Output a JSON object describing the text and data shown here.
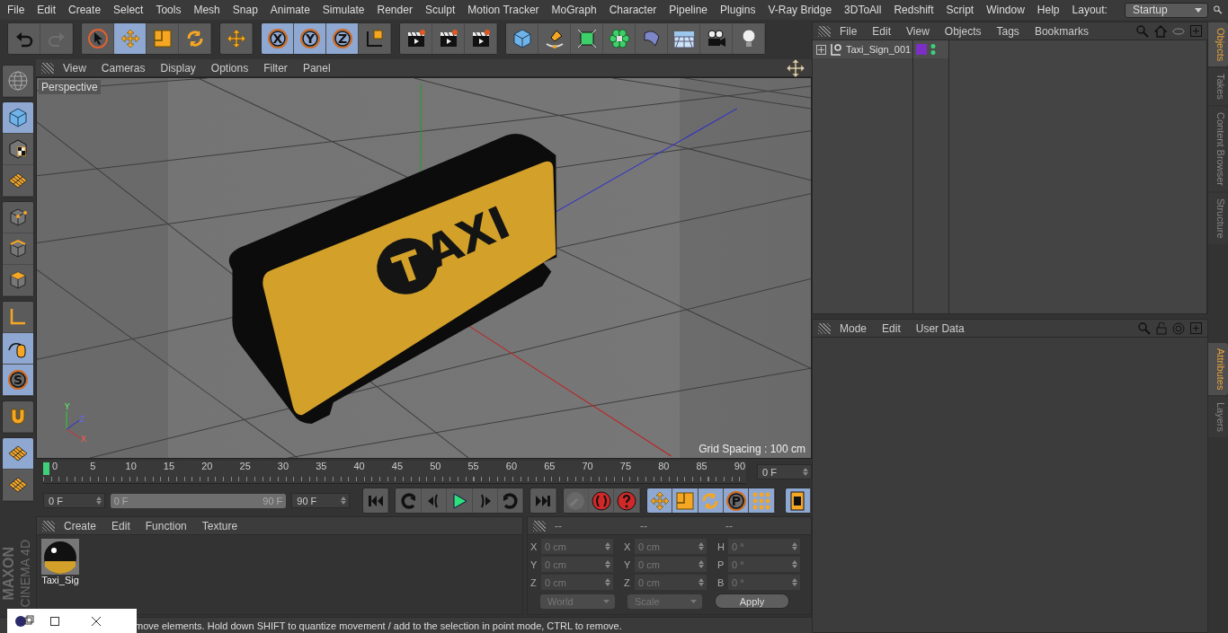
{
  "menu_bar": {
    "items": [
      "File",
      "Edit",
      "Create",
      "Select",
      "Tools",
      "Mesh",
      "Snap",
      "Animate",
      "Simulate",
      "Render",
      "Sculpt",
      "Motion Tracker",
      "MoGraph",
      "Character",
      "Pipeline",
      "Plugins",
      "V-Ray Bridge",
      "3DToAll",
      "Redshift",
      "Script",
      "Window",
      "Help"
    ],
    "layout_label": "Layout:",
    "layout_value": "Startup"
  },
  "toolbar": [
    [
      {
        "kind": "undo",
        "selected": false,
        "disabled": false
      },
      {
        "kind": "redo",
        "selected": false,
        "disabled": true
      }
    ],
    [
      {
        "kind": "select",
        "selected": false,
        "disabled": false
      },
      {
        "kind": "move",
        "selected": true,
        "disabled": false
      },
      {
        "kind": "scale",
        "selected": false,
        "disabled": false
      },
      {
        "kind": "rotate",
        "selected": false,
        "disabled": false
      }
    ],
    [
      {
        "kind": "move",
        "selected": false,
        "disabled": false
      }
    ],
    [
      {
        "kind": "axis",
        "label": "X",
        "selected": true,
        "disabled": false
      },
      {
        "kind": "axis",
        "label": "Y",
        "selected": true,
        "disabled": false
      },
      {
        "kind": "axis",
        "label": "Z",
        "selected": true,
        "disabled": false
      },
      {
        "kind": "coords",
        "selected": false,
        "disabled": false
      }
    ],
    [
      {
        "kind": "clapper",
        "selected": false,
        "disabled": false
      },
      {
        "kind": "clapper",
        "selected": false,
        "disabled": false
      },
      {
        "kind": "clapper",
        "selected": false,
        "disabled": false
      }
    ],
    [
      {
        "kind": "cube",
        "selected": false,
        "disabled": false
      },
      {
        "kind": "pen",
        "selected": false,
        "disabled": false
      },
      {
        "kind": "greencube",
        "selected": false,
        "disabled": false
      },
      {
        "kind": "flower",
        "selected": false,
        "disabled": false
      },
      {
        "kind": "bend",
        "selected": false,
        "disabled": false
      },
      {
        "kind": "floor",
        "selected": false,
        "disabled": false
      },
      {
        "kind": "camera",
        "selected": false,
        "disabled": false
      },
      {
        "kind": "bulb",
        "selected": false,
        "disabled": false
      }
    ]
  ],
  "left_tools": [
    [
      {
        "kind": "globe",
        "selected": false
      }
    ],
    [
      {
        "kind": "cube",
        "selected": true
      },
      {
        "kind": "checkcube",
        "selected": false
      },
      {
        "kind": "grid",
        "selected": false
      }
    ],
    [
      {
        "kind": "points",
        "selected": false
      },
      {
        "kind": "edges",
        "selected": false
      },
      {
        "kind": "polys",
        "selected": false
      }
    ],
    [
      {
        "kind": "corner",
        "selected": false
      },
      {
        "kind": "mouse",
        "selected": true
      },
      {
        "kind": "letter",
        "label": "S",
        "selected": true
      }
    ],
    [
      {
        "kind": "magnet",
        "selected": false
      }
    ],
    [
      {
        "kind": "grid",
        "selected": true
      },
      {
        "kind": "grid",
        "selected": false
      }
    ]
  ],
  "viewport": {
    "menu": [
      "View",
      "Cameras",
      "Display",
      "Options",
      "Filter",
      "Panel"
    ],
    "camera": "Perspective",
    "grid_spacing": "Grid Spacing : 100 cm",
    "axis_labels": [
      "Y",
      "Z",
      "X"
    ],
    "sign_letter": "T",
    "sign_text": "AXI"
  },
  "timeline": {
    "ticks": [
      "0",
      "5",
      "10",
      "15",
      "20",
      "25",
      "30",
      "35",
      "40",
      "45",
      "50",
      "55",
      "60",
      "65",
      "70",
      "75",
      "80",
      "85",
      "90"
    ],
    "level": 0,
    "current_frame": "0 F",
    "start": "0 F",
    "range_start": "0 F",
    "range_end": "90 F",
    "end": "90 F",
    "transport": [
      {
        "kind": "first"
      },
      {
        "kind": "prevkey"
      },
      {
        "kind": "prev"
      },
      {
        "kind": "play"
      },
      {
        "kind": "next"
      },
      {
        "kind": "nextkey"
      },
      {
        "kind": "last"
      }
    ],
    "record": [
      {
        "kind": "key",
        "disabled": true
      },
      {
        "kind": "record",
        "disabled": false
      },
      {
        "kind": "help",
        "disabled": false
      }
    ],
    "keys": [
      {
        "kind": "move",
        "selected": true
      },
      {
        "kind": "scale",
        "selected": true
      },
      {
        "kind": "rotate",
        "selected": true
      },
      {
        "kind": "letter",
        "label": "P",
        "selected": true
      },
      {
        "kind": "dots",
        "selected": true
      }
    ],
    "film_selected": true,
    "range": {
      "level": 1
    }
  },
  "materials": {
    "menu": [
      "Create",
      "Edit",
      "Function",
      "Texture"
    ],
    "items": [
      {
        "name": "Taxi_Sig"
      }
    ]
  },
  "coordinates": {
    "headers": [
      "--",
      "--",
      "--"
    ],
    "rows": [
      [
        {
          "label": "X",
          "value": "0 cm"
        },
        {
          "label": "X",
          "value": "0 cm"
        },
        {
          "label": "H",
          "value": "0 °"
        }
      ],
      [
        {
          "label": "Y",
          "value": "0 cm"
        },
        {
          "label": "Y",
          "value": "0 cm"
        },
        {
          "label": "P",
          "value": "0 °"
        }
      ],
      [
        {
          "label": "Z",
          "value": "0 cm"
        },
        {
          "label": "Z",
          "value": "0 cm"
        },
        {
          "label": "B",
          "value": "0 °"
        }
      ]
    ],
    "mode": "World",
    "type": "Scale",
    "apply": "Apply"
  },
  "objects": {
    "menu": [
      "File",
      "Edit",
      "View",
      "Objects",
      "Tags",
      "Bookmarks"
    ],
    "rows": [
      {
        "name": "Taxi_Sign_001",
        "color": "#7b2fc4",
        "expanded": false
      }
    ]
  },
  "attributes": {
    "menu": [
      "Mode",
      "Edit",
      "User Data"
    ]
  },
  "side_tabs_top": [
    {
      "label": "Objects",
      "selected": true
    },
    {
      "label": "Takes",
      "selected": false
    },
    {
      "label": "Content Browser",
      "selected": false
    },
    {
      "label": "Structure",
      "selected": false
    }
  ],
  "side_tabs_bottom": [
    {
      "label": "Attributes",
      "selected": true
    },
    {
      "label": "Layers",
      "selected": false
    }
  ],
  "brand": "MAXON",
  "brand_sub": "CINEMA 4D",
  "status": "move elements. Hold down SHIFT to quantize movement / add to the selection in point mode, CTRL to remove."
}
